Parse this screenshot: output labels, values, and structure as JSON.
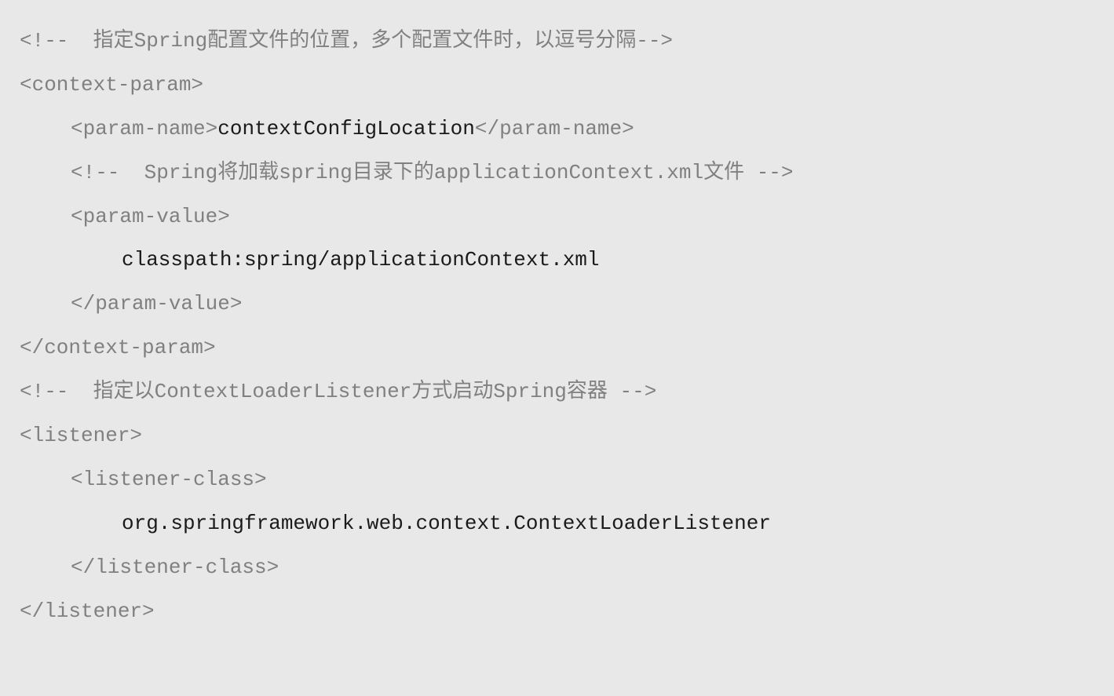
{
  "code": {
    "line1": "<!--  指定Spring配置文件的位置，多个配置文件时，以逗号分隔-->",
    "line2": "<context-param>",
    "line3_open": "<param-name>",
    "line3_content": "contextConfigLocation",
    "line3_close": "</param-name>",
    "line4": "<!--  Spring将加载spring目录下的applicationContext.xml文件 -->",
    "line5": "<param-value>",
    "line6": "classpath:spring/applicationContext.xml",
    "line7": "</param-value>",
    "line8": "</context-param>",
    "line9": "<!--  指定以ContextLoaderListener方式启动Spring容器 -->",
    "line10": "<listener>",
    "line11": "<listener-class>",
    "line12": "org.springframework.web.context.ContextLoaderListener",
    "line13": "</listener-class>",
    "line14": "</listener>"
  }
}
